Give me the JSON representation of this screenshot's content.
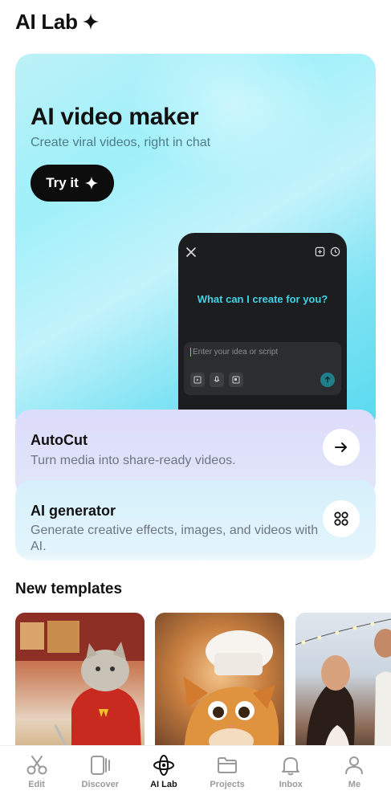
{
  "header": {
    "title": "AI Lab",
    "icon": "sparkle-icon"
  },
  "hero": {
    "title": "AI video maker",
    "subtitle": "Create viral videos, right in chat",
    "cta_label": "Try it",
    "preview": {
      "prompt_title": "What can I create for you?",
      "input_placeholder": "Enter your idea or script"
    }
  },
  "features": [
    {
      "title": "AutoCut",
      "description": "Turn media into share-ready videos.",
      "icon": "arrow-right-icon"
    },
    {
      "title": "AI generator",
      "description": "Generate creative effects, images, and videos with AI.",
      "icon": "grid-icon"
    }
  ],
  "templates": {
    "section_title": "New templates"
  },
  "bottom_nav": {
    "items": [
      {
        "label": "Edit",
        "icon": "scissors-icon"
      },
      {
        "label": "Discover",
        "icon": "discover-icon"
      },
      {
        "label": "AI Lab",
        "icon": "ai-lab-icon",
        "active": true
      },
      {
        "label": "Projects",
        "icon": "folder-icon"
      },
      {
        "label": "Inbox",
        "icon": "bell-icon"
      },
      {
        "label": "Me",
        "icon": "person-icon"
      }
    ]
  },
  "colors": {
    "accent": "#3fd2e6",
    "hero_bg": "#9ff0fa",
    "active_nav": "#111111",
    "inactive_nav": "#9a9a9a"
  }
}
